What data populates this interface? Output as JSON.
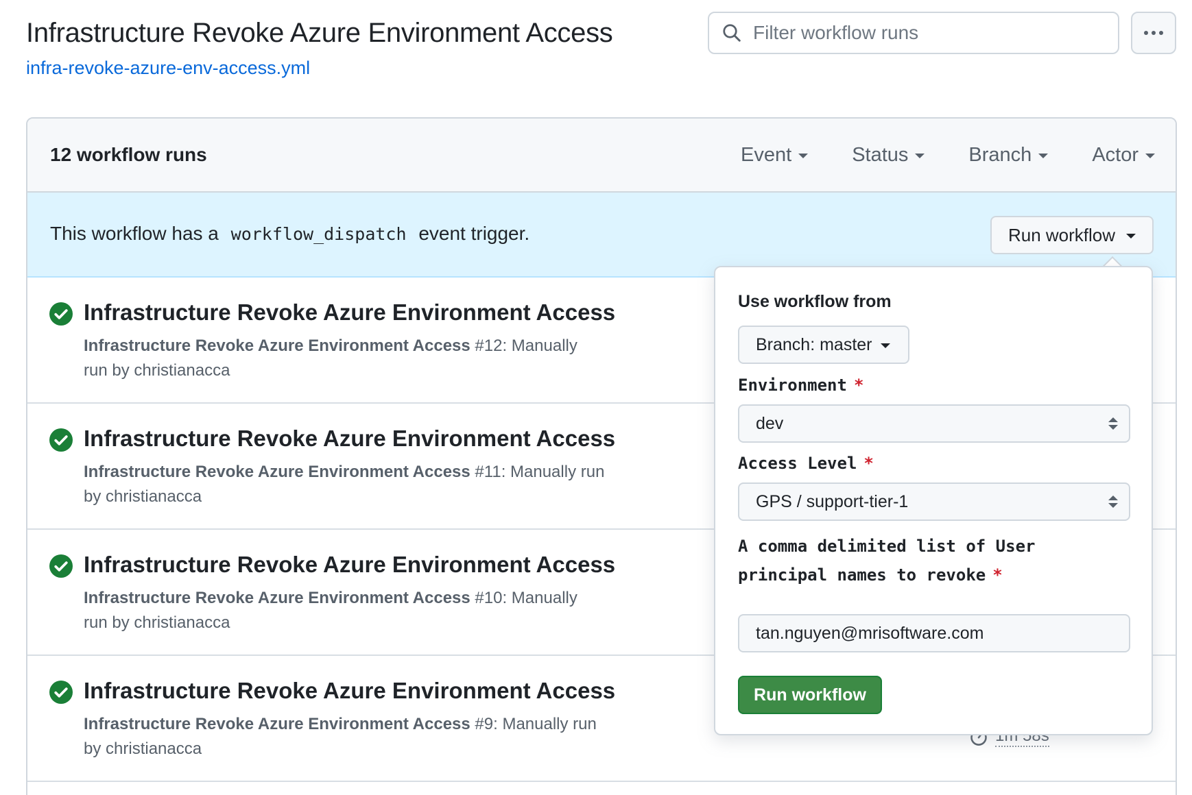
{
  "header": {
    "title": "Infrastructure Revoke Azure Environment Access",
    "yml_link": "infra-revoke-azure-env-access.yml",
    "filter_placeholder": "Filter workflow runs"
  },
  "runs_panel": {
    "count_label": "12 workflow runs",
    "filters": [
      "Event",
      "Status",
      "Branch",
      "Actor"
    ]
  },
  "dispatch_banner": {
    "text_before": "This workflow has a",
    "code": "workflow_dispatch",
    "text_after": "event trigger.",
    "run_button_label": "Run workflow"
  },
  "runs": [
    {
      "title": "Infrastructure Revoke Azure Environment Access",
      "workflow_name": "Infrastructure Revoke Azure Environment Access",
      "number": "#12",
      "meta_suffix": ": Manually run by christianacca",
      "status": "success"
    },
    {
      "title": "Infrastructure Revoke Azure Environment Access",
      "workflow_name": "Infrastructure Revoke Azure Environment Access",
      "number": "#11",
      "meta_suffix": ": Manually run by christianacca",
      "status": "success"
    },
    {
      "title": "Infrastructure Revoke Azure Environment Access",
      "workflow_name": "Infrastructure Revoke Azure Environment Access",
      "number": "#10",
      "meta_suffix": ": Manually run by christianacca",
      "status": "success"
    },
    {
      "title": "Infrastructure Revoke Azure Environment Access",
      "workflow_name": "Infrastructure Revoke Azure Environment Access",
      "number": "#9",
      "meta_suffix": ": Manually run by christianacca",
      "status": "success"
    }
  ],
  "partial_duration": "1m 58s",
  "popover": {
    "use_from_label": "Use workflow from",
    "branch_label": "Branch: master",
    "environment_label": "Environment",
    "environment_value": "dev",
    "access_level_label": "Access Level",
    "access_level_value": "GPS / support-tier-1",
    "upn_label_line1": "A comma delimited list of User",
    "upn_label_line2": "principal names to revoke",
    "upn_value": "tan.nguyen@mrisoftware.com",
    "required_mark": "*",
    "submit_label": "Run workflow"
  },
  "colors": {
    "success_green": "#1a7f37",
    "link_blue": "#0969da",
    "banner_bg": "#ddf4ff",
    "required_red": "#cf222e",
    "button_green": "#3d8b46"
  }
}
